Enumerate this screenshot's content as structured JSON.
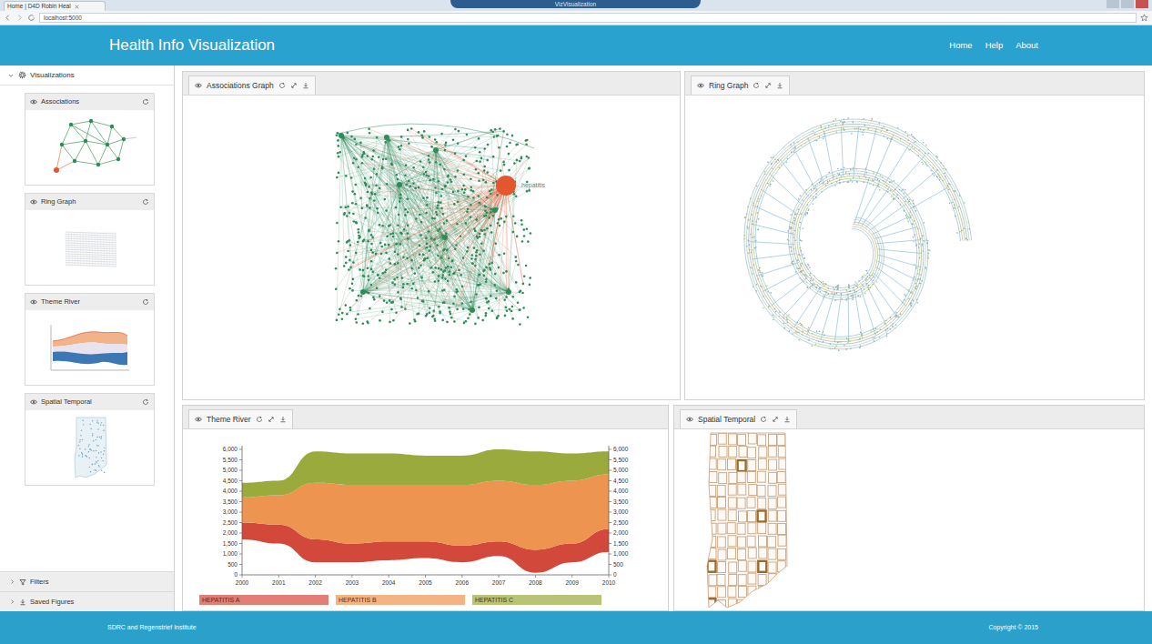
{
  "browser": {
    "tab_title": "Home | D4D Robin Heal",
    "window_title": "VizVisualization",
    "address": "localhost:5000"
  },
  "header": {
    "brand": "Health Info Visualization",
    "nav": [
      "Home",
      "Help",
      "About"
    ]
  },
  "sidebar": {
    "title": "Visualizations",
    "expanded": true,
    "items": [
      {
        "label": "Associations",
        "kind": "associations"
      },
      {
        "label": "Ring Graph",
        "kind": "ring"
      },
      {
        "label": "Theme River",
        "kind": "river"
      },
      {
        "label": "Spatial Temporal",
        "kind": "map"
      }
    ],
    "sections": [
      {
        "label": "Filters",
        "expanded": false
      },
      {
        "label": "Saved Figures",
        "expanded": false
      }
    ]
  },
  "panels": {
    "associations": {
      "title": "Associations Graph",
      "node_color": "#2e8b57",
      "highlight": {
        "label": "hepatitis",
        "color": "#e4572e"
      }
    },
    "ring": {
      "title": "Ring Graph"
    },
    "theme_river": {
      "title": "Theme River",
      "years": [
        "2000",
        "2001",
        "2002",
        "2003",
        "2004",
        "2005",
        "2006",
        "2007",
        "2008",
        "2009",
        "2010"
      ],
      "y_ticks": [
        "0",
        "500",
        "1,000",
        "1,500",
        "2,000",
        "2,500",
        "3,000",
        "3,500",
        "4,000",
        "4,500",
        "5,000",
        "5,500",
        "6,000"
      ],
      "y_max": 6000,
      "baseline": [
        1700,
        1500,
        600,
        600,
        700,
        800,
        600,
        900,
        100,
        600,
        1100
      ],
      "series": [
        {
          "name": "HEPATITIS A",
          "color": "#d2483a",
          "values": [
            800,
            900,
            1100,
            900,
            900,
            800,
            800,
            700,
            1100,
            900,
            1100
          ]
        },
        {
          "name": "HEPATITIS B",
          "color": "#ec9450",
          "values": [
            1200,
            1400,
            2700,
            2800,
            2700,
            2700,
            2900,
            2900,
            3100,
            3000,
            2600
          ]
        },
        {
          "name": "HEPATITIS C",
          "color": "#9aaa3c",
          "values": [
            700,
            700,
            1500,
            1500,
            1500,
            1400,
            1400,
            1500,
            1600,
            1300,
            1100
          ]
        }
      ]
    },
    "spatial": {
      "title": "Spatial Temporal"
    }
  },
  "footer": {
    "left": "SDRC and Regenstrief Institute",
    "right": "Copyright © 2015"
  }
}
